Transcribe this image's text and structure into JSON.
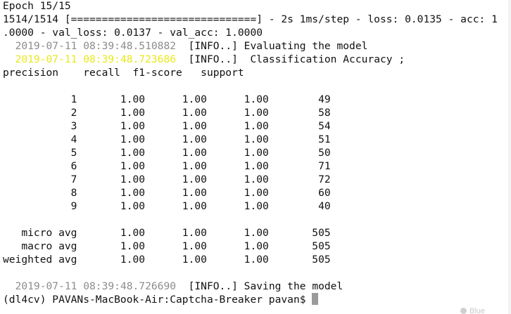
{
  "terminal": {
    "lines": [
      "Epoch 15/15",
      "1514/1514 [==============================] - 2s 1ms/step - loss: 0.0135 - acc: 1",
      ".0000 - val_loss: 0.0137 - val_acc: 1.0000",
      {
        "indent": "  ",
        "timestamp": "2019-07-11 08:39:48.510882",
        "text": "  [INFO..] Evaluating the model"
      },
      {
        "indent": "  ",
        "timestamp": "2019-07-11 08:39:48.723686",
        "text": "  [INFO..]  Classification Accuracy ;"
      },
      "precision    recall  f1-score   support",
      "",
      "           1       1.00      1.00      1.00        49",
      "           2       1.00      1.00      1.00        58",
      "           3       1.00      1.00      1.00        54",
      "           4       1.00      1.00      1.00        51",
      "           5       1.00      1.00      1.00        50",
      "           6       1.00      1.00      1.00        71",
      "           7       1.00      1.00      1.00        72",
      "           8       1.00      1.00      1.00        60",
      "           9       1.00      1.00      1.00        40",
      "",
      "   micro avg       1.00      1.00      1.00       505",
      "   macro avg       1.00      1.00      1.00       505",
      "weighted avg       1.00      1.00      1.00       505",
      "",
      {
        "indent": "  ",
        "timestamp": "2019-07-11 08:39:48.726690",
        "text": "  [INFO..] Saving the model"
      },
      "(dl4cv) PAVANs-MacBook-Air:Captcha-Breaker pavan$ "
    ],
    "cursor_icon": "block-cursor",
    "timestamp_colors": [
      "#8c8c8c",
      "#e8e81c",
      "#8c8c8c"
    ]
  },
  "background_hint": {
    "label": "Blue",
    "icon": "color-dot-icon"
  }
}
